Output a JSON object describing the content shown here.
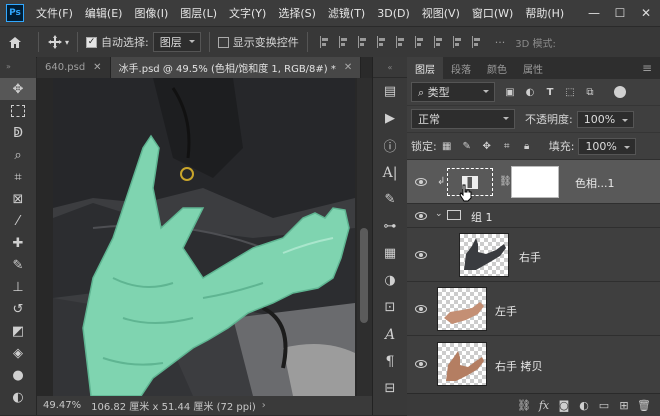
{
  "app": {
    "logo": "Ps"
  },
  "menu": [
    "文件(F)",
    "编辑(E)",
    "图像(I)",
    "图层(L)",
    "文字(Y)",
    "选择(S)",
    "滤镜(T)",
    "3D(D)",
    "视图(V)",
    "窗口(W)",
    "帮助(H)"
  ],
  "window_controls": {
    "minimize": "—",
    "maximize": "☐",
    "close": "✕"
  },
  "options": {
    "auto_select_label": "自动选择:",
    "auto_select_checked": true,
    "auto_select_value": "图层",
    "show_transform_label": "显示变换控件",
    "show_transform_checked": false,
    "mode_label": "3D 模式:"
  },
  "tabs": [
    {
      "label": "640.psd",
      "active": false
    },
    {
      "label": "冰手.psd @ 49.5% (色相/饱和度 1, RGB/8#) *",
      "active": true
    }
  ],
  "status": {
    "zoom": "49.47%",
    "doc_size": "106.82 厘米 x 51.44 厘米 (72 ppi)"
  },
  "layers_panel": {
    "tabs": [
      {
        "label": "图层",
        "active": true
      },
      {
        "label": "段落",
        "active": false
      },
      {
        "label": "颜色",
        "active": false
      },
      {
        "label": "属性",
        "active": false
      }
    ],
    "filter_kind": "类型",
    "blend_mode": "正常",
    "opacity_label": "不透明度:",
    "opacity_value": "100%",
    "lock_label": "锁定:",
    "fill_label": "填充:",
    "fill_value": "100%",
    "layers": [
      {
        "name": "色相...1",
        "type": "adjustment",
        "selected": true,
        "visible": true
      },
      {
        "name": "组 1",
        "type": "group",
        "visible": true
      },
      {
        "name": "右手",
        "type": "pixel",
        "visible": true
      },
      {
        "name": "左手",
        "type": "pixel",
        "visible": true
      },
      {
        "name": "右手 拷贝",
        "type": "pixel",
        "visible": true
      }
    ]
  },
  "colors": {
    "accent": "#31a8ff",
    "hand_tint": "#7fd4b0",
    "selected_layer": "#595959"
  }
}
